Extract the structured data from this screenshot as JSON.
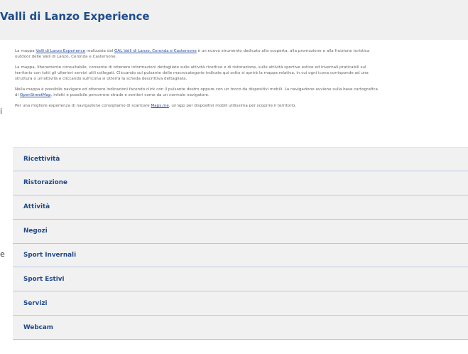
{
  "header": {
    "title": "Valli di Lanzo Experience"
  },
  "intro": {
    "p1_line1_a": "La mappa ",
    "p1_link1": "Valli di Lanzo Experience",
    "p1_line1_b": " realizzata dal ",
    "p1_link2": "GAL Valli di Lanzo, Ceronda e Casternone",
    "p1_line1_c": " è un nuovo strumento dedicato alla scoperta, alla promozione e alla fruizione turistica",
    "p1_line2": "outdoor delle Valli di Lanzo, Ceronda e Casternone.",
    "p2_line1": "La mappa, liberamente consultabile, consente di ottenere informazioni dettagliate sulle attività ricettive e di ristorazione, sulle attività sportive estive ed invernali praticabili sul",
    "p2_line2": "territorio con tutti gli ulteriori servizi utili collegati. Cliccando sul pulsante delle macrocategorie indicate qui sotto si aprirà la mappa relativa, in cui ogni icona corrisponde ad una",
    "p2_line3": "struttura o un'attività e cliccando sull'icona si otterrà la scheda descrittiva dettagliata.",
    "p3_line1": "Nella mappa è possibile navigare ed ottenere indicazioni facendo click con il pulsante destro oppure con un tocco da dispositivi mobili. La navigazione avviene sulla base cartografica",
    "p3_line2_a": "di ",
    "p3_link": "OpenStreetMap",
    "p3_line2_b": ", infatti è possibile percorrere strade e sentieri come da un normale navigatore.",
    "p4_a": "Per una migliore esperienza di navigazione consigliamo di scaricare ",
    "p4_link": "Maps.me",
    "p4_b": ", un'app per dispositivi mobili utilissima per scoprire il territorio."
  },
  "side_fragments": {
    "left1": "i",
    "left2": "e"
  },
  "categories": [
    {
      "label": "Ricettività"
    },
    {
      "label": "Ristorazione"
    },
    {
      "label": "Attività"
    },
    {
      "label": "Negozi"
    },
    {
      "label": "Sport Invernali"
    },
    {
      "label": "Sport Estivi"
    },
    {
      "label": "Servizi"
    },
    {
      "label": "Webcam"
    }
  ]
}
